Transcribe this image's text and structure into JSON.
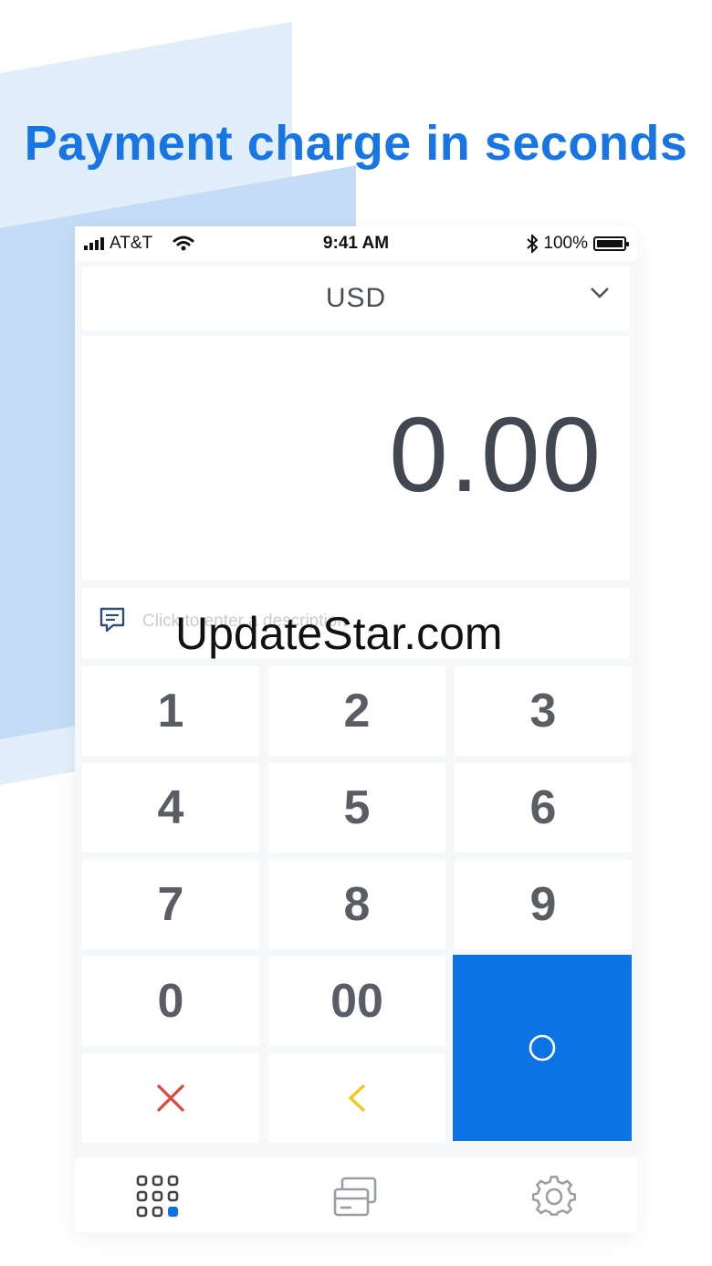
{
  "headline": "Payment charge in seconds",
  "status_bar": {
    "carrier": "AT&T",
    "time": "9:41 AM",
    "battery": "100%"
  },
  "currency": {
    "selected": "USD",
    "icon": "chevron-down-icon"
  },
  "amount": "0.00",
  "description": {
    "placeholder": "Click to enter a description",
    "icon": "message-icon"
  },
  "watermark": "UpdateStar.com",
  "keypad": {
    "k1": "1",
    "k2": "2",
    "k3": "3",
    "k4": "4",
    "k5": "5",
    "k6": "6",
    "k7": "7",
    "k8": "8",
    "k9": "9",
    "k0": "0",
    "k00": "00",
    "clear_icon": "close-icon",
    "backspace_icon": "chevron-left-icon",
    "charge_icon": "circle-icon"
  },
  "tabbar": {
    "tabs": [
      "keypad-icon",
      "cards-icon",
      "gear-icon"
    ],
    "active": "keypad-icon"
  },
  "colors": {
    "accent": "#0b73e4",
    "headline": "#1875e4",
    "clear": "#e0463c",
    "backspace": "#f4c918"
  }
}
